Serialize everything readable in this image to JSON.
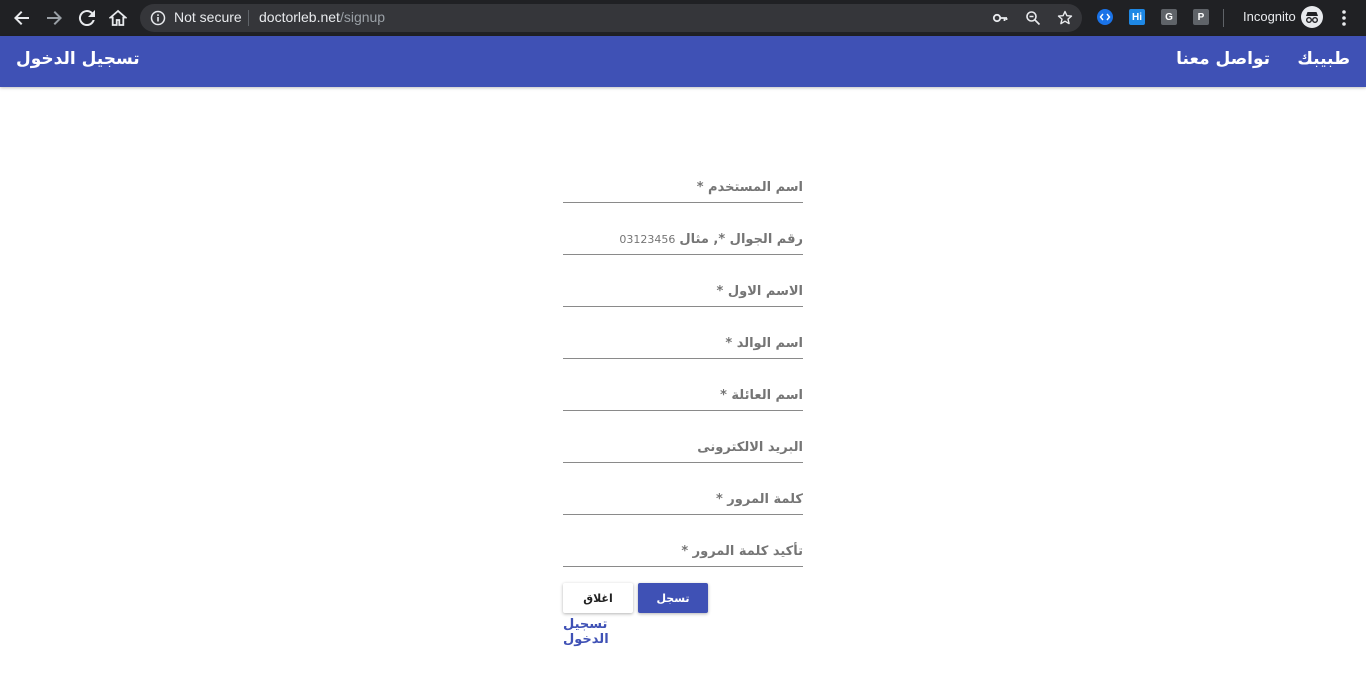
{
  "browser": {
    "security_label": "Not secure",
    "url_host": "doctorleb.net",
    "url_path": "/signup",
    "incognito_label": "Incognito",
    "extensions": [
      {
        "icon": "code-extension-icon",
        "text": "",
        "color": "#1a73e8"
      },
      {
        "icon": "hi-extension-icon",
        "text": "Hi",
        "color": "#1e88e5"
      },
      {
        "icon": "g-extension-icon",
        "text": "G",
        "color": "#5f6368"
      },
      {
        "icon": "p-extension-icon",
        "text": "P",
        "color": "#5f6368"
      }
    ]
  },
  "appbar": {
    "brand": "طبيبك",
    "contact": "تواصل معنا",
    "login": "تسجيل الدخول",
    "color": "#3f51b5"
  },
  "form": {
    "fields": [
      {
        "label": "اسم المستخدم *",
        "hint": ""
      },
      {
        "label": "رقم الجوال *, مثال",
        "hint": "03123456"
      },
      {
        "label": "الاسم الاول *",
        "hint": ""
      },
      {
        "label": "اسم الوالد *",
        "hint": ""
      },
      {
        "label": "اسم العائلة *",
        "hint": ""
      },
      {
        "label": "البريد الالكترونى",
        "hint": ""
      },
      {
        "label": "كلمة المرور *",
        "hint": ""
      },
      {
        "label": "تأكيد كلمة المرور *",
        "hint": ""
      }
    ],
    "close_button": "اغلاق",
    "signup_button": "تسجل",
    "login_link": "تسجيل الدخول"
  }
}
